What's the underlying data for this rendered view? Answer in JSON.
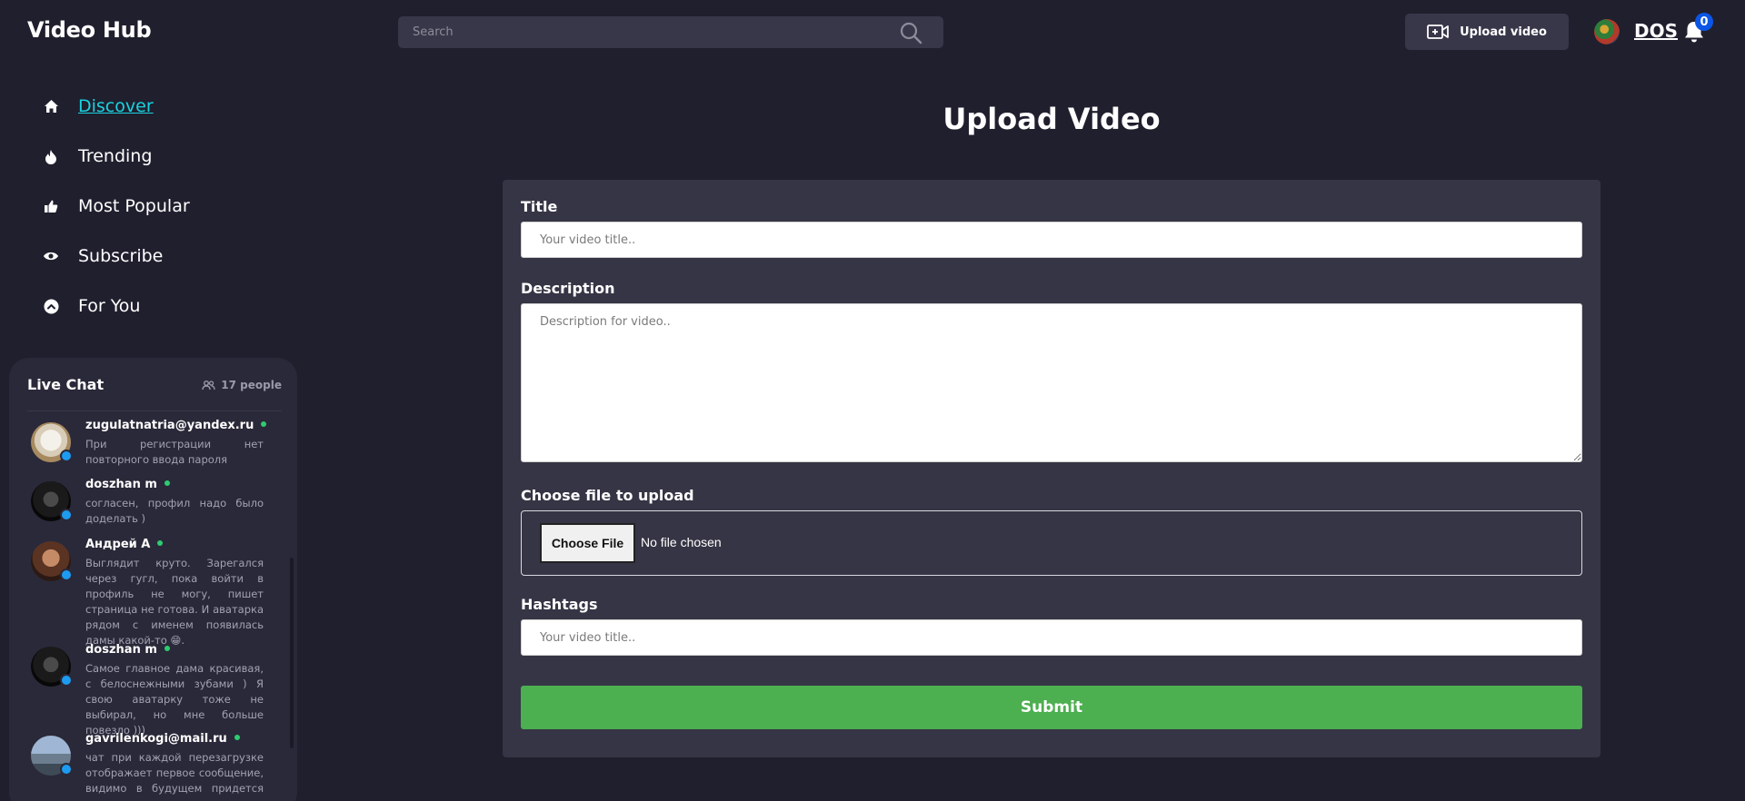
{
  "header": {
    "logo": "Video Hub",
    "search_placeholder": "Search",
    "upload_label": "Upload video",
    "username": "DOS",
    "notification_count": "0"
  },
  "nav": {
    "items": [
      {
        "label": "Discover",
        "icon": "home-icon",
        "active": true
      },
      {
        "label": "Trending",
        "icon": "fire-icon"
      },
      {
        "label": "Most Popular",
        "icon": "thumbs-up-icon"
      },
      {
        "label": "Subscribe",
        "icon": "eye-icon"
      },
      {
        "label": "For You",
        "icon": "chevron-up-circle-icon"
      }
    ]
  },
  "chat": {
    "title": "Live Chat",
    "people": "17 people",
    "messages": [
      {
        "name": "zugulatnatria@yandex.ru",
        "text": "При регистрации нет повторного ввода пароля"
      },
      {
        "name": "doszhan m",
        "text": "согласен, профил надо было доделать )"
      },
      {
        "name": "Андрей А",
        "text": "Выглядит круто. Зарегался через гугл, пока войти в профиль не могу, пишет страница не готова. И аватарка рядом с именем появилась дамы какой-то 😁."
      },
      {
        "name": "doszhan m",
        "text": "Самое главное дама красивая, с белоснежными зубами ) Я свою аватарку тоже не выбирал, но мне больше повезло )))"
      },
      {
        "name": "gavrilenkogi@mail.ru",
        "text": "чат при каждой перезагрузке отображает первое сообщение, видимо в будущем придется всю"
      }
    ]
  },
  "form": {
    "page_title": "Upload Video",
    "title_label": "Title",
    "title_placeholder": "Your video title..",
    "description_label": "Description",
    "description_placeholder": "Description for video..",
    "file_label": "Choose file to upload",
    "file_button": "Choose File",
    "file_status": "No file chosen",
    "hashtags_label": "Hashtags",
    "hashtags_placeholder": "Your video title..",
    "submit_label": "Submit"
  },
  "colors": {
    "background": "#201f2e",
    "card": "#363545",
    "accent_link": "#19d3e0",
    "submit": "#4caf50",
    "badge": "#0b56e6"
  }
}
